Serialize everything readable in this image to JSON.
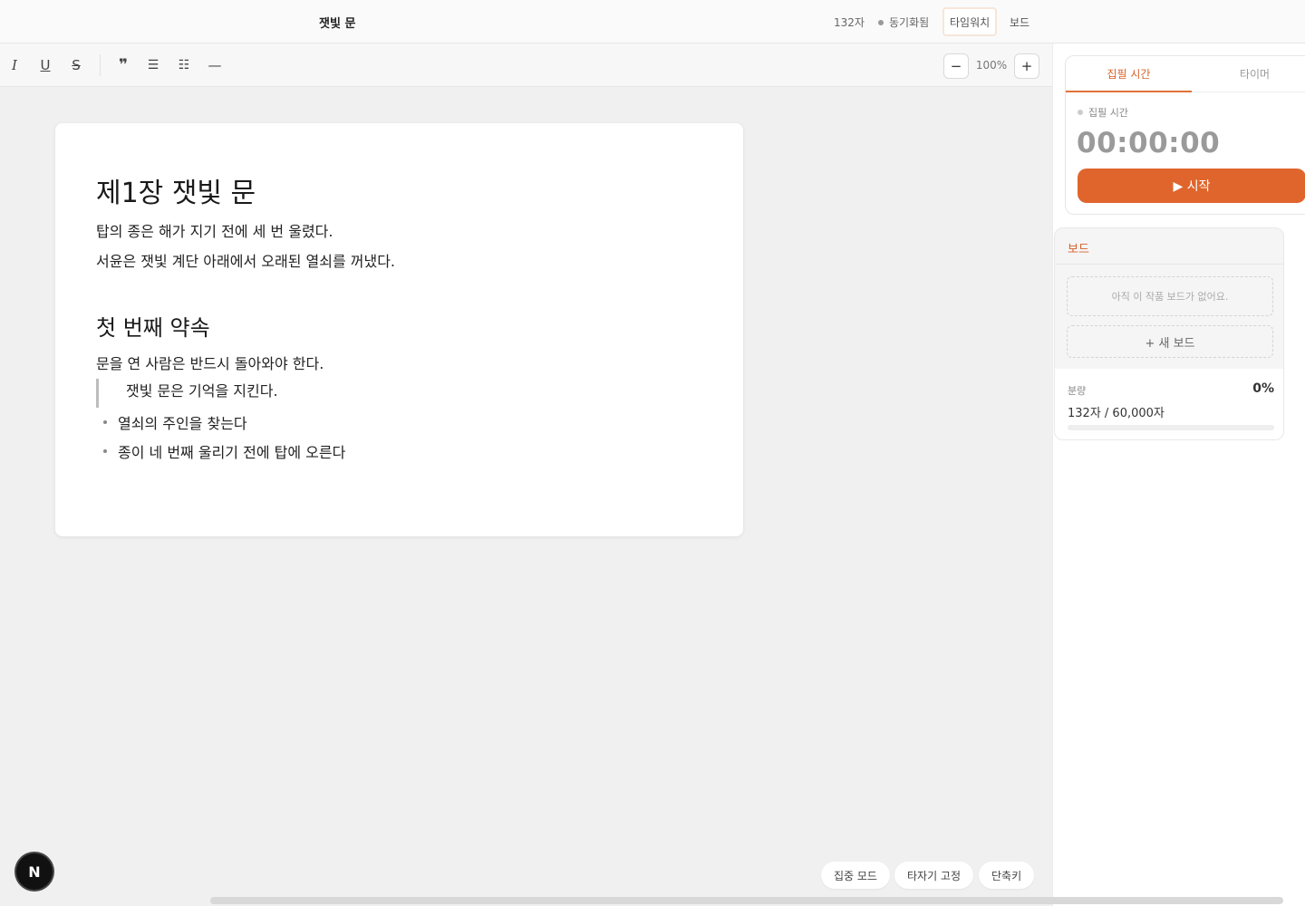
{
  "header": {
    "title": "잿빛 문",
    "char_count": "132자",
    "sync_status": "동기화됨",
    "tab_stopwatch": "타임워치",
    "tab_board": "보드"
  },
  "toolbar": {
    "italic": "I",
    "underline": "U",
    "strike": "S",
    "quote": "❞",
    "bullet_list": "☰",
    "numbered_list": "☷",
    "divider": "—",
    "zoom_out": "−",
    "zoom_value": "100%",
    "zoom_in": "+"
  },
  "document": {
    "heading1": "제1장 잿빛 문",
    "para1": "탑의 종은 해가 지기 전에 세 번 울렸다.",
    "para2": "서윤은 잿빛 계단 아래에서 오래된 열쇠를 꺼냈다.",
    "heading2": "첫 번째 약속",
    "para3": "문을 연 사람은 반드시 돌아와야 한다.",
    "quote": "잿빛 문은 기억을 지킨다.",
    "bullets": [
      "열쇠의 주인을 찾는다",
      "종이 네 번째 울리기 전에 탑에 오른다"
    ]
  },
  "timer": {
    "tab_focus": "집필 시간",
    "tab_timer": "타이머",
    "label": "집필 시간",
    "time": "00:00:00",
    "start": "▶ 시작"
  },
  "board": {
    "title": "보드",
    "empty": "아직 이 작품 보드가 없어요.",
    "new_board": "+ 새 보드",
    "volume_label": "분량",
    "volume_percent": "0%",
    "volume_count": "132자 / 60,000자",
    "progress": 0
  },
  "bottom": {
    "focus_mode": "집중 모드",
    "typewriter": "타자기 고정",
    "shortcuts": "단축키"
  },
  "badge": {
    "letter": "N"
  }
}
